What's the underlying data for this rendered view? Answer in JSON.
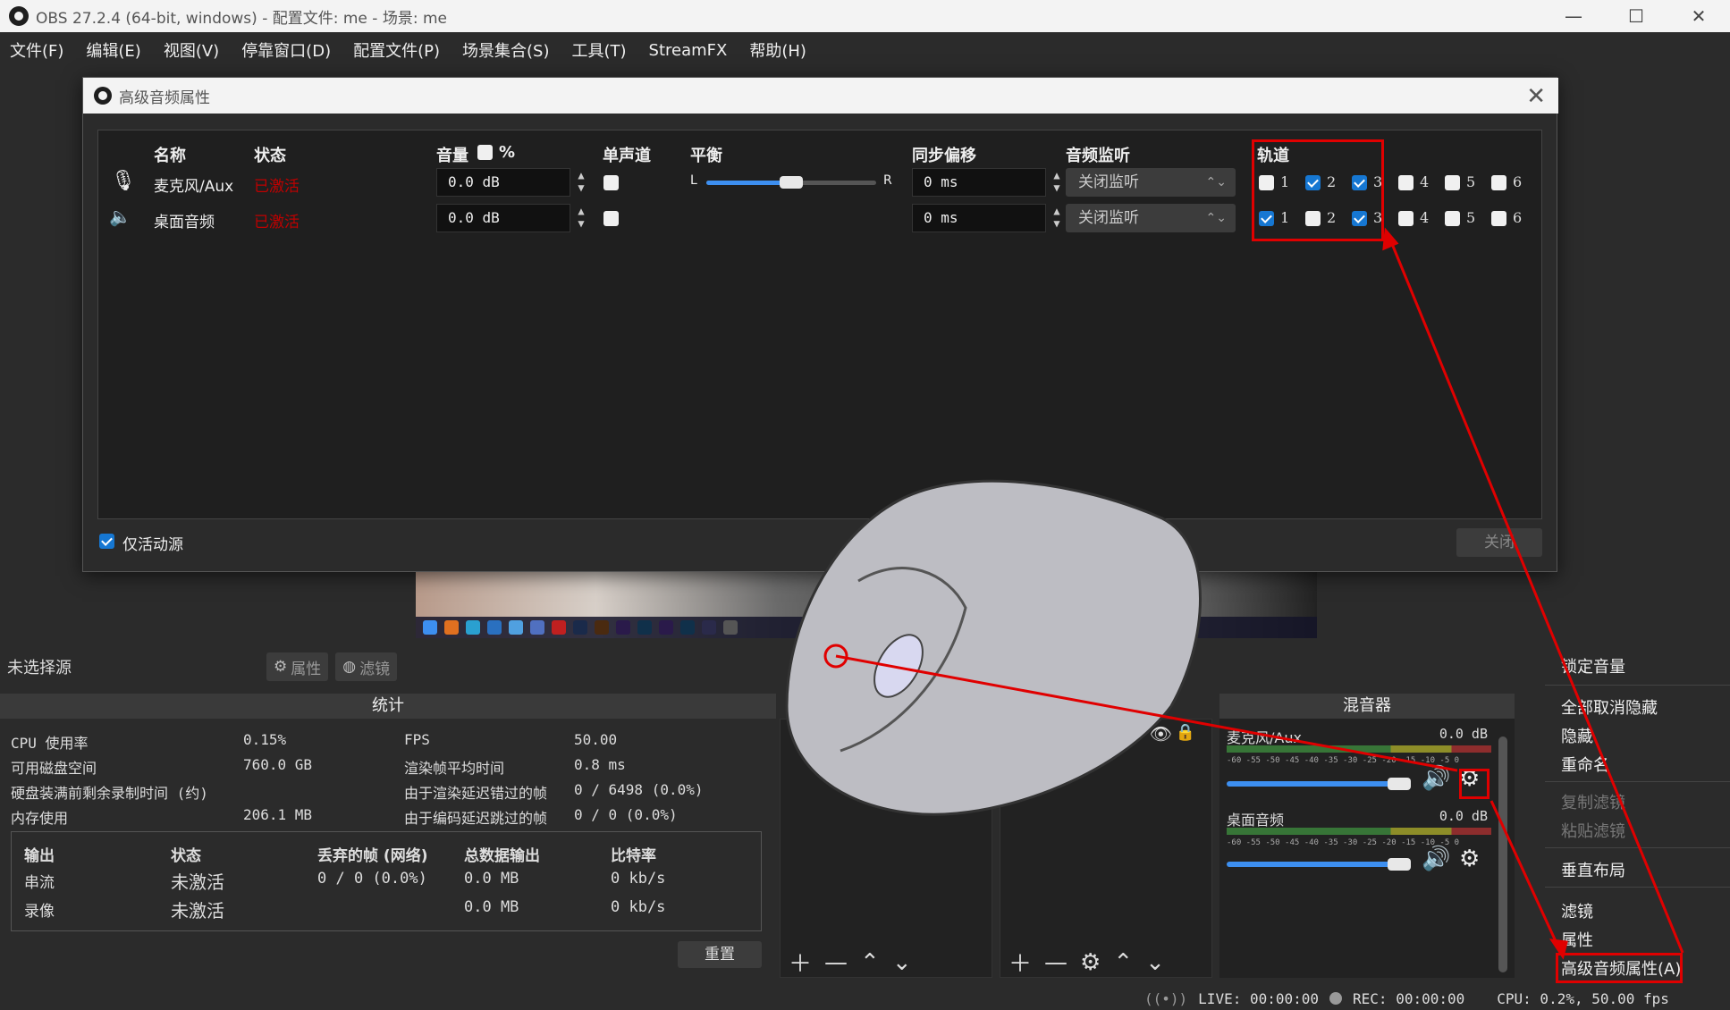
{
  "window": {
    "title": "OBS 27.2.4 (64-bit, windows) - 配置文件: me - 场景: me"
  },
  "menu": [
    "文件(F)",
    "编辑(E)",
    "视图(V)",
    "停靠窗口(D)",
    "配置文件(P)",
    "场景集合(S)",
    "工具(T)",
    "StreamFX",
    "帮助(H)"
  ],
  "dialog": {
    "title": "高级音频属性",
    "columns": {
      "name": "名称",
      "status": "状态",
      "volume": "音量",
      "volume_pct": "%",
      "mono": "单声道",
      "balance": "平衡",
      "sync": "同步偏移",
      "monitor": "音频监听",
      "tracks": "轨道"
    },
    "rows": [
      {
        "name": "麦克风/Aux",
        "status": "已激活",
        "volume": "0.0 dB",
        "mono": false,
        "balance_l": "L",
        "balance_r": "R",
        "balance_value": 0.5,
        "sync": "0 ms",
        "monitor": "关闭监听",
        "tracks": [
          false,
          true,
          true,
          false,
          false,
          false
        ]
      },
      {
        "name": "桌面音频",
        "status": "已激活",
        "volume": "0.0 dB",
        "mono": false,
        "sync": "0 ms",
        "monitor": "关闭监听",
        "tracks": [
          true,
          false,
          true,
          false,
          false,
          false
        ]
      }
    ],
    "track_labels": [
      "1",
      "2",
      "3",
      "4",
      "5",
      "6"
    ],
    "active_only_label": "仅活动源",
    "active_only_checked": true,
    "close_label": "关闭"
  },
  "sources_bar": {
    "no_selection": "未选择源",
    "properties": "属性",
    "filters": "滤镜"
  },
  "stats": {
    "title": "统计",
    "cpu_label": "CPU 使用率",
    "cpu_value": "0.15%",
    "disk_label": "可用磁盘空间",
    "disk_value": "760.0 GB",
    "disk_time_label": "硬盘装满前剩余录制时间 (约)",
    "mem_label": "内存使用",
    "mem_value": "206.1 MB",
    "fps_label": "FPS",
    "fps_value": "50.00",
    "render_label": "渲染帧平均时间",
    "render_value": "0.8 ms",
    "lag_label": "由于渲染延迟错过的帧",
    "lag_value": "0 / 6498 (0.0%)",
    "enc_label": "由于编码延迟跳过的帧",
    "enc_value": "0 / 0 (0.0%)",
    "output_headers": [
      "输出",
      "状态",
      "丢弃的帧 (网络)",
      "总数据输出",
      "比特率"
    ],
    "outputs": [
      {
        "name": "串流",
        "status": "未激活",
        "dropped": "0 / 0 (0.0%)",
        "total": "0.0 MB",
        "bitrate": "0 kb/s"
      },
      {
        "name": "录像",
        "status": "未激活",
        "dropped": "",
        "total": "0.0 MB",
        "bitrate": "0 kb/s"
      }
    ],
    "reset_label": "重置"
  },
  "mixer": {
    "title": "混音器",
    "channels": [
      {
        "name": "麦克风/Aux",
        "db": "0.0 dB",
        "level": 1.0
      },
      {
        "name": "桌面音频",
        "db": "0.0 dB",
        "level": 1.0
      }
    ],
    "scale": "-60 -55 -50 -45 -40 -35 -30 -25 -20 -15 -10 -5 0"
  },
  "context_menu": {
    "items": [
      "锁定音量",
      "全部取消隐藏",
      "隐藏",
      "重命名",
      "复制滤镜",
      "粘贴滤镜",
      "垂直布局",
      "滤镜",
      "属性",
      "高级音频属性(A)"
    ]
  },
  "status": {
    "live": "LIVE: 00:00:00",
    "rec": "REC: 00:00:00",
    "cpu": "CPU: 0.2%, 50.00 fps"
  },
  "colors": {
    "accent": "#1677d2",
    "highlight": "#e00000",
    "active_status": "#c00000"
  }
}
